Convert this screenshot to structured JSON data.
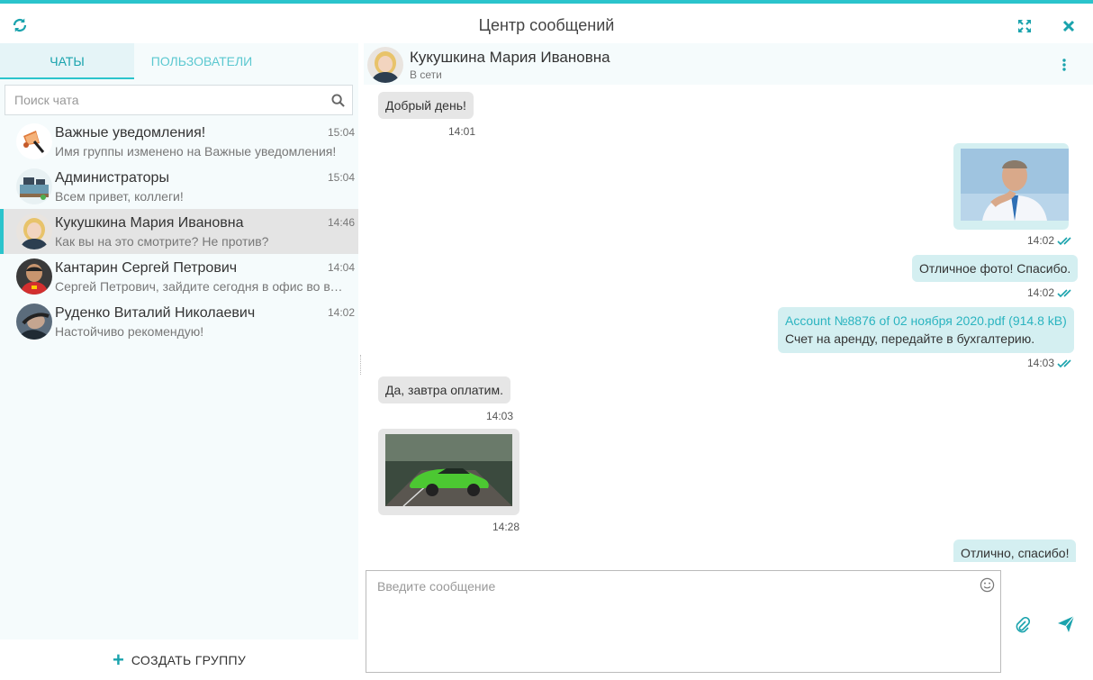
{
  "app": {
    "title": "Центр сообщений",
    "accent": "#2bc4cc"
  },
  "tabs": [
    {
      "label": "Чаты",
      "active": true
    },
    {
      "label": "Пользователи",
      "active": false
    }
  ],
  "search": {
    "placeholder": "Поиск чата",
    "value": ""
  },
  "chats": [
    {
      "name": "Важные уведомления!",
      "time": "15:04",
      "preview": "Имя группы изменено на Важные уведомления!",
      "avatar": "megaphone-avatar"
    },
    {
      "name": "Администраторы",
      "time": "15:04",
      "preview": "Всем привет, коллеги!",
      "avatar": "desk-avatar"
    },
    {
      "name": "Кукушкина Мария Ивановна",
      "time": "14:46",
      "preview": "Как вы на это смотрите? Не против?",
      "avatar": "woman-avatar",
      "selected": true
    },
    {
      "name": "Кантарин Сергей Петрович",
      "time": "14:04",
      "preview": "Сергей Петрович, зайдите сегодня в офис во второй половине дня",
      "avatar": "racer-avatar"
    },
    {
      "name": "Руденко Виталий Николаевич",
      "time": "14:02",
      "preview": "Настойчиво рекомендую!",
      "avatar": "man-avatar"
    }
  ],
  "create_group": {
    "label": "Создать группу"
  },
  "conversation": {
    "name": "Кукушкина Мария Ивановна",
    "status": "В сети",
    "messages": [
      {
        "direction": "in",
        "text": "Добрый день!",
        "time": "14:01"
      },
      {
        "direction": "out",
        "type": "image",
        "image": "man-thinking-photo",
        "time": "14:02",
        "read": true
      },
      {
        "direction": "out",
        "text": "Отличное фото! Спасибо.",
        "time": "14:02",
        "read": true
      },
      {
        "direction": "out",
        "type": "file",
        "file_link": "Account №8876 of 02 ноября 2020.pdf (914.8 kB)",
        "text": "Счет на аренду, передайте в бухгалтерию.",
        "time": "14:03",
        "read": true
      },
      {
        "direction": "in",
        "text": "Да, завтра оплатим.",
        "time": "14:03"
      },
      {
        "direction": "in",
        "type": "image",
        "image": "green-car-photo",
        "time": "14:28"
      },
      {
        "direction": "out",
        "text": "Отлично, спасибо!"
      }
    ]
  },
  "composer": {
    "placeholder": "Введите сообщение",
    "value": ""
  }
}
